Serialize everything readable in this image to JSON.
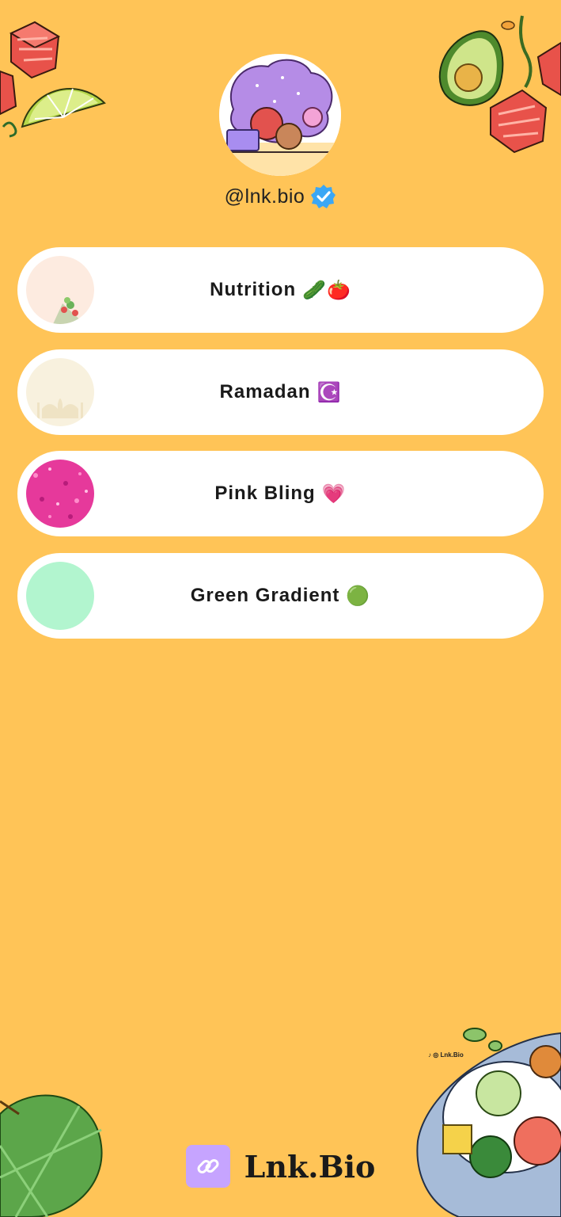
{
  "profile": {
    "handle": "@lnk.bio",
    "verified_icon": "verified-badge-icon",
    "avatar_icon": "cartoon-avatar"
  },
  "links": [
    {
      "label": "Nutrition",
      "emoji": "🥒🍅",
      "thumb": "salad-thumb"
    },
    {
      "label": "Ramadan",
      "emoji": "☪️",
      "thumb": "mosque-thumb"
    },
    {
      "label": "Pink Bling",
      "emoji": "💗",
      "thumb": "pink-glitter-thumb"
    },
    {
      "label": "Green Gradient",
      "emoji": "🟢",
      "thumb": "mint-circle-thumb"
    }
  ],
  "footer": {
    "brand": "Lnk.Bio",
    "logo_icon": "chain-link-icon"
  },
  "decor": {
    "bowl_tag": "Lnk.Bio"
  },
  "colors": {
    "background": "#FFC457",
    "card": "#FFFFFF",
    "verified": "#3BA7F5",
    "brand_logo": "#C6A4FF"
  }
}
